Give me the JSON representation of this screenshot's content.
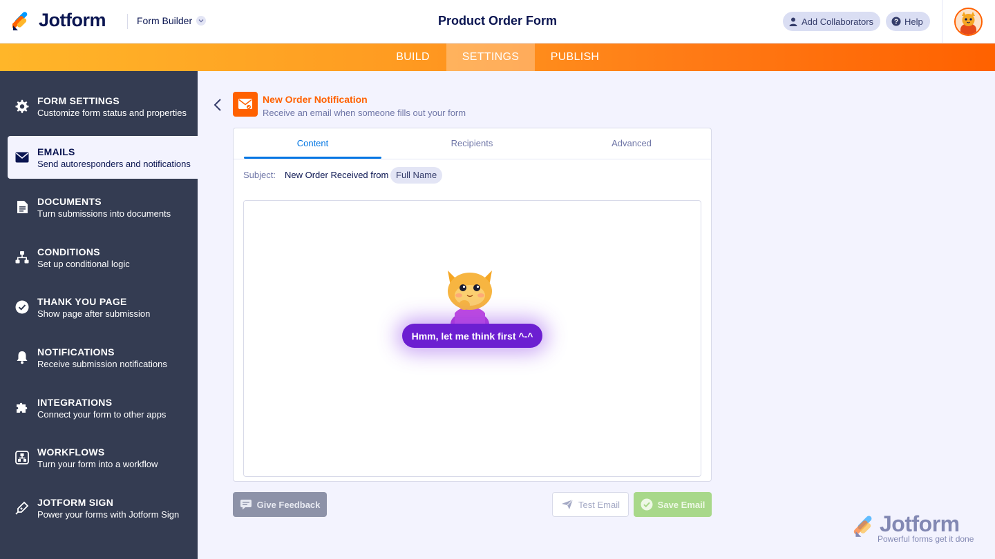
{
  "header": {
    "brand": "Jotform",
    "builder_label": "Form Builder",
    "form_title": "Product Order Form",
    "add_collaborators": "Add Collaborators",
    "help": "Help"
  },
  "tabs": [
    {
      "label": "BUILD"
    },
    {
      "label": "SETTINGS"
    },
    {
      "label": "PUBLISH"
    }
  ],
  "sidebar": {
    "items": [
      {
        "title": "FORM SETTINGS",
        "subtitle": "Customize form status and properties",
        "icon": "gear-icon"
      },
      {
        "title": "EMAILS",
        "subtitle": "Send autoresponders and notifications",
        "icon": "envelope-icon"
      },
      {
        "title": "DOCUMENTS",
        "subtitle": "Turn submissions into documents",
        "icon": "document-icon"
      },
      {
        "title": "CONDITIONS",
        "subtitle": "Set up conditional logic",
        "icon": "hierarchy-icon"
      },
      {
        "title": "THANK YOU PAGE",
        "subtitle": "Show page after submission",
        "icon": "check-circle-icon"
      },
      {
        "title": "NOTIFICATIONS",
        "subtitle": "Receive submission notifications",
        "icon": "bell-icon"
      },
      {
        "title": "INTEGRATIONS",
        "subtitle": "Connect your form to other apps",
        "icon": "puzzle-icon"
      },
      {
        "title": "WORKFLOWS",
        "subtitle": "Turn your form into a workflow",
        "icon": "workflow-icon"
      },
      {
        "title": "JOTFORM SIGN",
        "subtitle": "Power your forms with Jotform Sign",
        "icon": "pen-icon"
      }
    ]
  },
  "notification": {
    "title": "New Order Notification",
    "subtitle": "Receive an email when someone fills out your form"
  },
  "panel": {
    "tabs": [
      {
        "label": "Content"
      },
      {
        "label": "Recipients"
      },
      {
        "label": "Advanced"
      }
    ],
    "subject_label": "Subject:",
    "subject_text": "New Order Received from",
    "subject_chip": "Full Name",
    "thinking": "Hmm, let me think first ^-^"
  },
  "buttons": {
    "feedback": "Give Feedback",
    "test_email": "Test Email",
    "save_email": "Save Email"
  },
  "watermark": {
    "brand": "Jotform",
    "tagline": "Powerful forms get it done"
  },
  "colors": {
    "accent": "#ff6100",
    "sidebar": "#343c52",
    "primary_blue": "#0075e3",
    "purple": "#6c1fd1"
  }
}
